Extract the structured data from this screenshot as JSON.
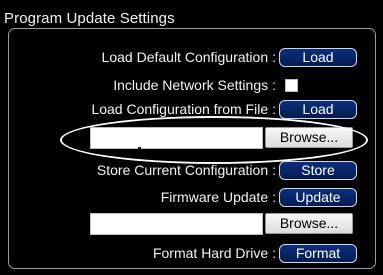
{
  "panel": {
    "title": "Program Update Settings"
  },
  "rows": {
    "load_default": {
      "label": "Load Default Configuration",
      "button": "Load"
    },
    "include_network": {
      "label": "Include Network Settings",
      "checked": false
    },
    "load_from_file": {
      "label": "Load Configuration from File",
      "button": "Load"
    },
    "config_file": {
      "value": "",
      "browse": "Browse..."
    },
    "store_current": {
      "label": "Store Current Configuration",
      "button": "Store"
    },
    "firmware_update": {
      "label": "Firmware Update",
      "button": "Update"
    },
    "firmware_file": {
      "value": "",
      "browse": "Browse..."
    },
    "format_drive": {
      "label": "Format Hard Drive",
      "button": "Format"
    }
  },
  "separator": ":",
  "colors": {
    "background": "#000000",
    "text": "#f2f2f2",
    "button": "#0a2f7e",
    "highlight": "#ffffff"
  }
}
